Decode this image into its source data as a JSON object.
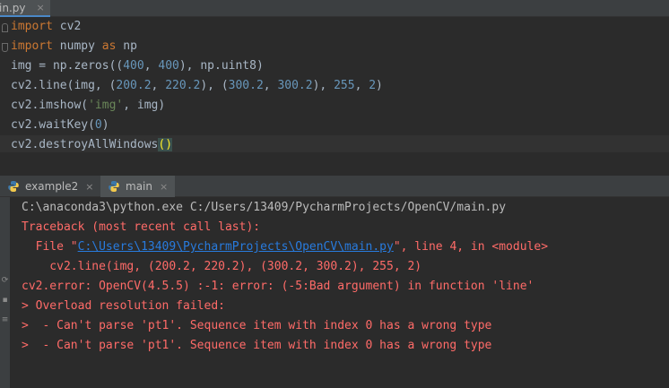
{
  "editor_tab": {
    "label": "in.py",
    "close": "×"
  },
  "code": {
    "line1": {
      "kw": "import",
      "rest": " cv2"
    },
    "line2": {
      "kw1": "import",
      "mid": " numpy ",
      "kw2": "as",
      "rest": " np"
    },
    "line3": {
      "pre": "img = np.zeros((",
      "n1": "400",
      "sep": ", ",
      "n2": "400",
      "post": "), np.uint8)"
    },
    "line4": {
      "pre": "cv2.line(img, (",
      "n1": "200.2",
      "s1": ", ",
      "n2": "220.2",
      "s2": "), (",
      "n3": "300.2",
      "s3": ", ",
      "n4": "300.2",
      "s4": "), ",
      "n5": "255",
      "s5": ", ",
      "n6": "2",
      "post": ")"
    },
    "line5": {
      "pre": "cv2.imshow(",
      "str": "'img'",
      "post": ", img)"
    },
    "line6": {
      "pre": "cv2.waitKey(",
      "n1": "0",
      "post": ")"
    },
    "line7": {
      "pre": "cv2.destroyAllWindows",
      "paren": "()"
    }
  },
  "run_tabs": [
    {
      "label": "example2",
      "close": "×"
    },
    {
      "label": "main",
      "close": "×"
    }
  ],
  "console": {
    "cmd": "C:\\anaconda3\\python.exe C:/Users/13409/PycharmProjects/OpenCV/main.py",
    "traceback": "Traceback (most recent call last):",
    "file_pre": "  File \"",
    "file_link": "C:\\Users\\13409\\PycharmProjects\\OpenCV\\main.py",
    "file_post": "\", line 4, in <module>",
    "src": "    cv2.line(img, (200.2, 220.2), (300.2, 300.2), 255, 2)",
    "error": "cv2.error: OpenCV(4.5.5) :-1: error: (-5:Bad argument) in function 'line'",
    "overload": "> Overload resolution failed:",
    "detail1": ">  - Can't parse 'pt1'. Sequence item with index 0 has a wrong type",
    "detail2": ">  - Can't parse 'pt1'. Sequence item with index 0 has a wrong type"
  },
  "colors": {
    "keyword": "#cc7832",
    "number": "#6897bb",
    "string": "#6a8759",
    "error": "#ff6b68",
    "link": "#287bde",
    "background": "#2b2b2b"
  }
}
